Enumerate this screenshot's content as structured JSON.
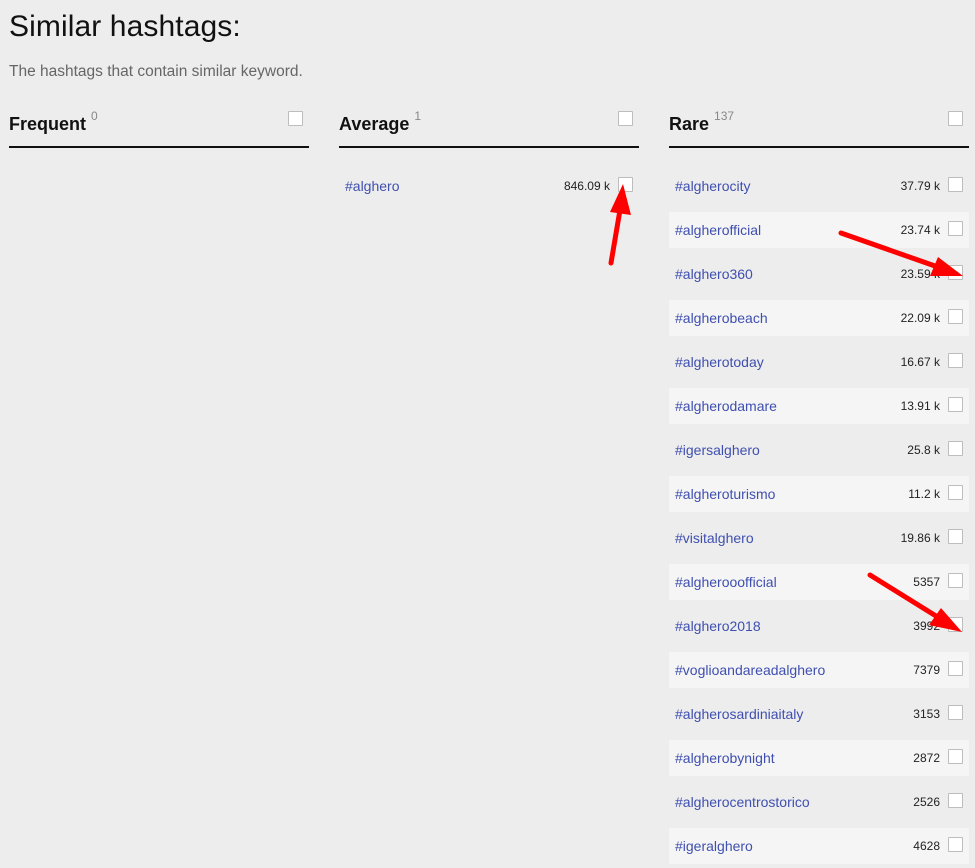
{
  "page": {
    "title": "Similar hashtags:",
    "subtitle": "The hashtags that contain similar keyword."
  },
  "columns": [
    {
      "title": "Frequent",
      "count": "0",
      "items": []
    },
    {
      "title": "Average",
      "count": "1",
      "items": [
        {
          "tag": "#alghero",
          "count": "846.09 k"
        }
      ]
    },
    {
      "title": "Rare",
      "count": "137",
      "items": [
        {
          "tag": "#algherocity",
          "count": "37.79 k"
        },
        {
          "tag": "#algherofficial",
          "count": "23.74 k"
        },
        {
          "tag": "#alghero360",
          "count": "23.59 k"
        },
        {
          "tag": "#algherobeach",
          "count": "22.09 k"
        },
        {
          "tag": "#algherotoday",
          "count": "16.67 k"
        },
        {
          "tag": "#algherodamare",
          "count": "13.91 k"
        },
        {
          "tag": "#igersalghero",
          "count": "25.8 k"
        },
        {
          "tag": "#algheroturismo",
          "count": "11.2 k"
        },
        {
          "tag": "#visitalghero",
          "count": "19.86 k"
        },
        {
          "tag": "#algherooofficial",
          "count": "5357"
        },
        {
          "tag": "#alghero2018",
          "count": "3992"
        },
        {
          "tag": "#voglioandareadalghero",
          "count": "7379"
        },
        {
          "tag": "#algherosardiniaitaly",
          "count": "3153"
        },
        {
          "tag": "#algherobynight",
          "count": "2872"
        },
        {
          "tag": "#algherocentrostorico",
          "count": "2526"
        },
        {
          "tag": "#igeralghero",
          "count": "4628"
        }
      ]
    }
  ],
  "colors": {
    "background": "#ededed",
    "link": "#3f4fb0",
    "alt_row": "#f5f5f5",
    "annotation_arrow": "#ff0000"
  },
  "annotations": {
    "arrow_icon": "red-arrow-icon"
  }
}
